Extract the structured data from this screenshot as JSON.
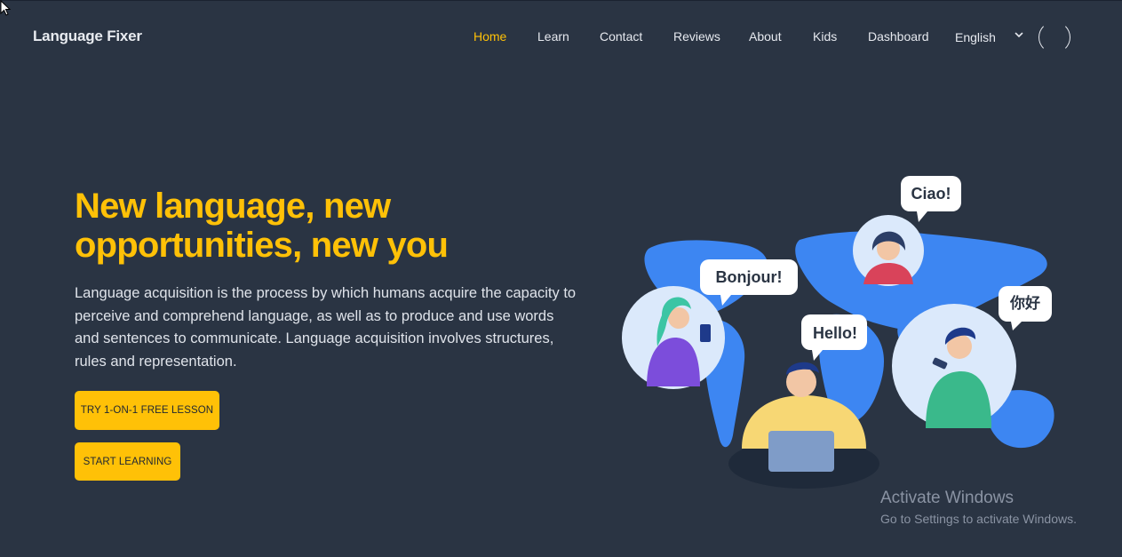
{
  "brand": {
    "name": "Language Fixer"
  },
  "nav": {
    "items": [
      {
        "label": "Home",
        "active": true
      },
      {
        "label": "Learn",
        "active": false
      },
      {
        "label": "Contact",
        "active": false
      },
      {
        "label": "Reviews",
        "active": false
      },
      {
        "label": "About",
        "active": false
      },
      {
        "label": "Kids",
        "active": false
      },
      {
        "label": "Dashboard",
        "active": false
      }
    ],
    "language": "English",
    "language_icon": "chevron-down-icon",
    "avatar_icon": "user-avatar-icon"
  },
  "hero": {
    "title": "New language, new opportunities, new you",
    "description": "Language acquisition is the process by which humans acquire the capacity to perceive and comprehend language, as well as to produce and use words and sentences to communicate. Language acquisition involves structures, rules and representation.",
    "cta_trial": "TRY 1-ON-1 FREE LESSON",
    "cta_start": "START LEARNING"
  },
  "illustration": {
    "bubbles": [
      "Bonjour!",
      "Ciao!",
      "Hello!",
      "你好"
    ]
  },
  "windows_watermark": {
    "title": "Activate Windows",
    "subtitle": "Go to Settings to activate Windows."
  },
  "colors": {
    "background": "#2a3443",
    "accent": "#ffc107",
    "map_blue": "#3d86f2"
  }
}
